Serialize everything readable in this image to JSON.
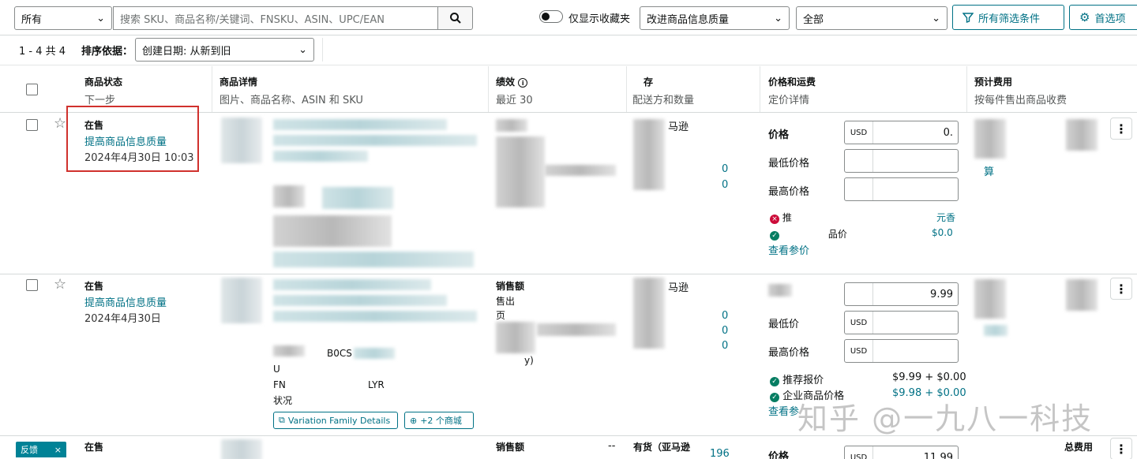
{
  "toolbar": {
    "category_select": "所有",
    "search_placeholder": "搜索 SKU、商品名称/关键词、FNSKU、ASIN、UPC/EAN",
    "favorites_toggle_label": "仅显示收藏夹",
    "quality_filter": "改进商品信息质量",
    "status_filter": "全部",
    "all_filters_button": "所有筛选条件",
    "preferences_button": "首选项"
  },
  "results": {
    "count": "1 - 4 共 4",
    "sort_label": "排序依据：",
    "sort_value": "创建日期:   从新到旧"
  },
  "columns": [
    {
      "title": "商品状态",
      "sub": "下一步"
    },
    {
      "title": "商品详情",
      "sub": "图片、商品名称、ASIN 和 SKU"
    },
    {
      "title": "绩效",
      "sub": "最近 30"
    },
    {
      "title": "存",
      "sub": "配送方和数量"
    },
    {
      "title": "价格和运费",
      "sub": "定价详情"
    },
    {
      "title": "预计费用",
      "sub": "按每件售出商品收费"
    }
  ],
  "rows": [
    {
      "status": "在售",
      "action": "提高商品信息质量",
      "date": "2024年4月30日 10:03",
      "inventory": "马逊",
      "inventory_nums": [
        "0",
        "0"
      ],
      "price_label": "价格",
      "price_value": "0.",
      "min_price_label": "最低价格",
      "max_price_label": "最高价格",
      "currency": "USD",
      "rec_label": "推",
      "rec_value": "元香",
      "biz_label": "品价",
      "biz_value": "$0.0",
      "view_link": "查看参价",
      "fee_link": "算"
    },
    {
      "status": "在售",
      "action": "提高商品信息质量",
      "date": "2024年4月30日",
      "perf_label": "销售额",
      "perf_sub": "售出",
      "perf_sub2": "页",
      "perf_end": "y)",
      "inventory": "马逊",
      "inventory_nums": [
        "0",
        "0",
        "0"
      ],
      "price_value": "9.99",
      "min_price_label": "最低价",
      "max_price_label": "最高价格",
      "currency": "USD",
      "rec_label": "推荐报价",
      "rec_value": "$9.99 + $0.00",
      "biz_label": "企业商品价格",
      "biz_value": "$9.98 + $0.00",
      "view_link": "查看参",
      "asin_fragment": "B0CS",
      "fnsku_fragment": "FN",
      "fnsku_tail": "LYR",
      "sku_fragment": "U",
      "condition_label": "状况",
      "variation_button": "Variation Family Details",
      "marketplace_button": "+2 个商城"
    },
    {
      "status": "在售",
      "perf_label": "销售额",
      "perf_dash": "--",
      "inventory": "有货（亚马逊",
      "inventory_num": "196",
      "price_label": "价格",
      "price_value": "11.99",
      "currency": "USD",
      "fee_label": "总费用"
    }
  ],
  "feedback_label": "反馈",
  "watermark": "知乎 @一九八一科技"
}
